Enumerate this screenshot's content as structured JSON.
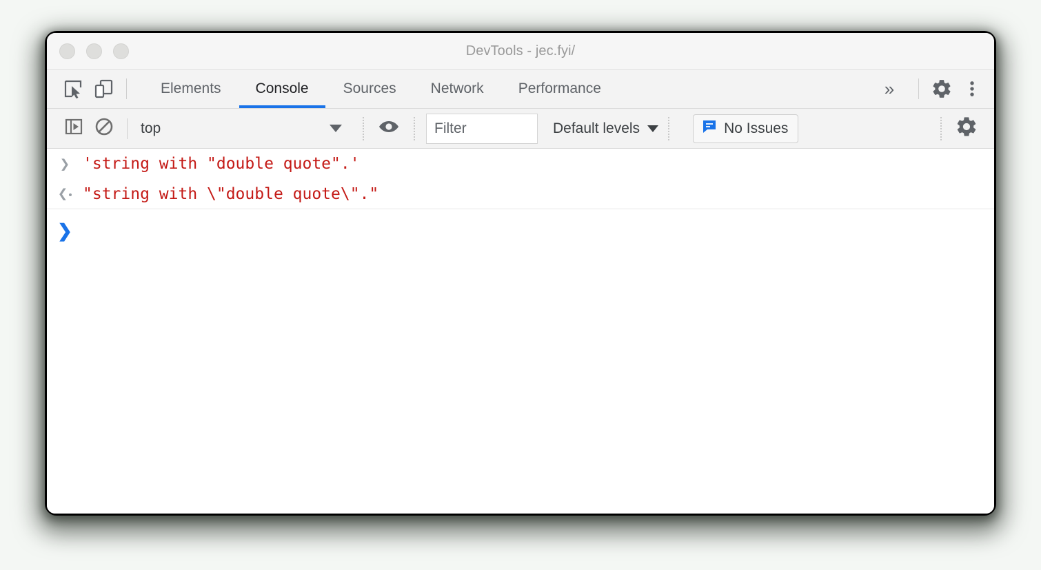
{
  "window": {
    "title": "DevTools - jec.fyi/",
    "traffic_lights": [
      "close",
      "minimize",
      "maximize"
    ]
  },
  "tabbar": {
    "inspect_icon": "inspect-element-icon",
    "device_icon": "device-toolbar-icon",
    "tabs": [
      {
        "label": "Elements",
        "active": false
      },
      {
        "label": "Console",
        "active": true
      },
      {
        "label": "Sources",
        "active": false
      },
      {
        "label": "Network",
        "active": false
      },
      {
        "label": "Performance",
        "active": false
      }
    ],
    "more_tabs_label": "»",
    "settings_icon": "gear-icon",
    "menu_icon": "more-vertical-icon"
  },
  "console_toolbar": {
    "sidebar_toggle_icon": "console-sidebar-toggle-icon",
    "clear_icon": "clear-console-icon",
    "context": {
      "value": "top",
      "caret": "chevron-down-icon"
    },
    "eye_icon": "live-expression-eye-icon",
    "filter": {
      "value": "",
      "placeholder": "Filter"
    },
    "levels": {
      "label": "Default levels",
      "caret": "chevron-down-icon"
    },
    "issues": {
      "label": "No Issues",
      "icon": "issues-message-icon",
      "icon_color": "#1a73e8"
    },
    "settings_icon": "gear-icon"
  },
  "console": {
    "rows": [
      {
        "kind": "input",
        "gutter_icon": "prompt-chevron-right-icon",
        "text": "'string with \"double quote\".'"
      },
      {
        "kind": "result",
        "gutter_icon": "result-chevron-left-icon",
        "text": "\"string with \\\"double quote\\\".\""
      }
    ],
    "prompt": {
      "gutter_icon": "prompt-chevron-right-icon",
      "glyph": "❯",
      "input_value": ""
    },
    "text_color": "#c41a16"
  },
  "colors": {
    "accent": "#1a73e8",
    "string_red": "#c41a16",
    "toolbar_bg": "#f3f3f3",
    "titlebar_bg": "#f6f6f6",
    "body_bg": "#ffffff",
    "desktop_bg": "#f4f7f4"
  }
}
